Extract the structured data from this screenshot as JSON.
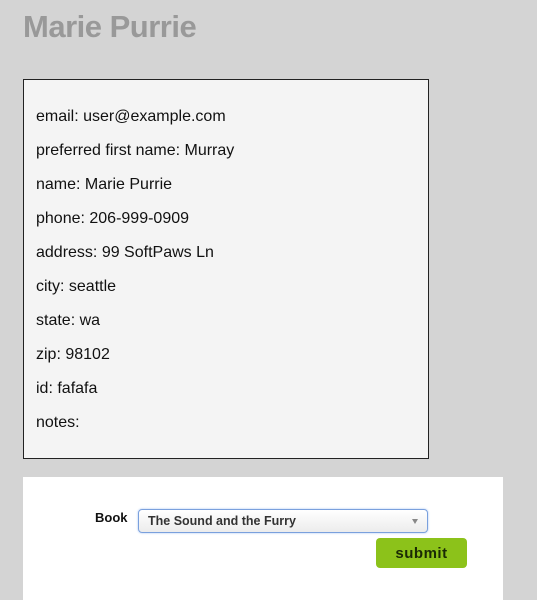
{
  "header": {
    "title": "Marie Purrie"
  },
  "profile": {
    "fields": [
      {
        "text": "email: user@example.com"
      },
      {
        "text": "preferred first name: Murray"
      },
      {
        "text": "name: Marie Purrie"
      },
      {
        "text": "phone: 206-999-0909"
      },
      {
        "text": "address: 99 SoftPaws Ln"
      },
      {
        "text": "city: seattle"
      },
      {
        "text": "state: wa"
      },
      {
        "text": "zip: 98102"
      },
      {
        "text": "id: fafafa"
      },
      {
        "text": "notes:"
      }
    ]
  },
  "form": {
    "book_label": "Book",
    "book_selected": "The Sound and the Furry",
    "submit_label": "submit"
  },
  "icons": {
    "select_arrow": "chevron-down-icon"
  },
  "colors": {
    "background": "#d4d4d4",
    "title": "#999999",
    "card_background": "#f4f4f4",
    "submit_button": "#8cc21a",
    "select_focus": "#7aa0dd"
  }
}
